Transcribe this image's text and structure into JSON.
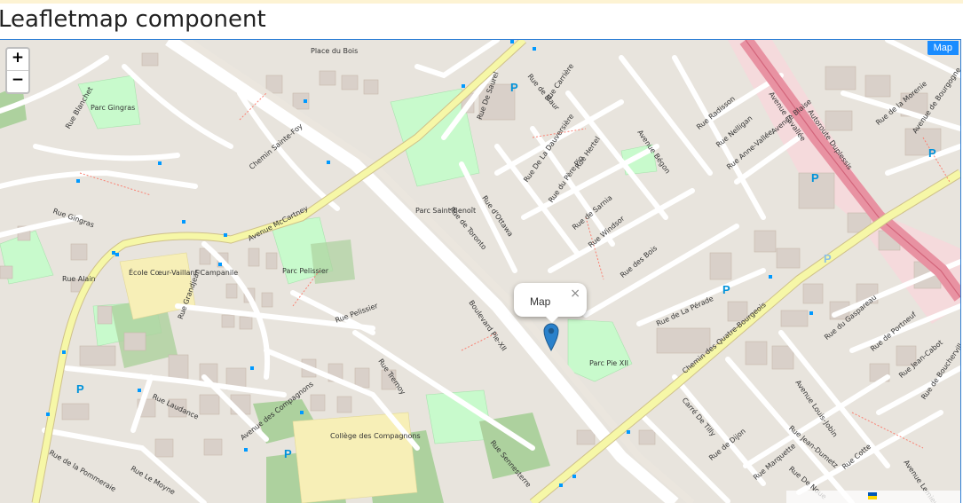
{
  "page": {
    "title": "Leafletmap component"
  },
  "map": {
    "tag": "Map",
    "zoom_in": "+",
    "zoom_out": "−",
    "popup": {
      "text": "Map",
      "close": "×"
    },
    "labels": [
      "Rue Alain",
      "Rue Gingras",
      "Rue Blanchet",
      "Parc Gingras",
      "Chemin Sainte-Foy",
      "Avenue McCartney",
      "Parc Saint-Benoît",
      "Rue De Saurel",
      "Rue de Toronto",
      "Rue d'Ottawa",
      "Rue Hertel",
      "Rue de Sarnia",
      "Rue Windsor",
      "Rue des Bois",
      "Avenue Bégon",
      "Rue De La Dauversière",
      "Rue du Père Pio",
      "Rue Radisson",
      "Rue Nelligan",
      "Rue Anne-Vallée",
      "Autoroute Duplessis",
      "Avenue Lavallée",
      "Rue de la Morenie",
      "Avenue de Bourgogne",
      "Rue de La Pérade",
      "Chemin des Quatre-Bourgeois",
      "Boulevard Pie-XII",
      "Parc Pie XII",
      "Rue Pelissier",
      "Parc Pelissier",
      "École Cœur-Vaillant-Campanile",
      "Rue Grandjean",
      "Rue Laudance",
      "Rue Tremoy",
      "Avenue des Compagnons",
      "Collège des Compagnons",
      "Rue Sennesterre",
      "Rue de la Pommeraie",
      "Rue Le Moyne",
      "Rue de Dijon",
      "Rue Marquette",
      "Rue De Noue",
      "Rue Cotte",
      "Rue Jean-Dumetz",
      "Carré De Tilly",
      "Avenue Louis-Jobin",
      "Rue du Gaspareau",
      "Rue de Portneuf",
      "Rue Jean-Cabot",
      "Rue de Boucherville",
      "Avenue Lemieux",
      "Avenue Blaise",
      "Rue de Maur",
      "Rue Carrière",
      "Place du Bois"
    ]
  }
}
